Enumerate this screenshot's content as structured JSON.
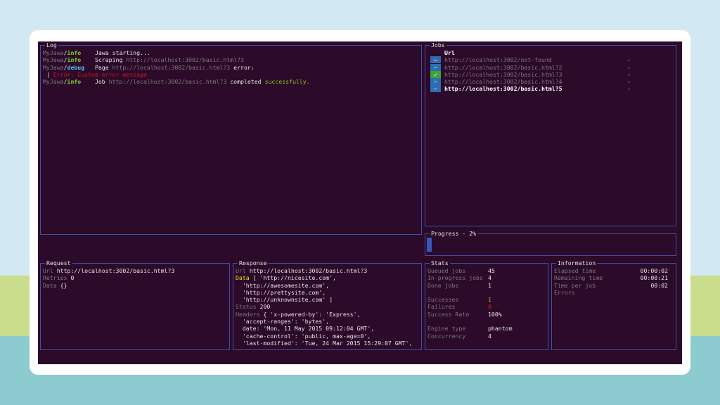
{
  "log": {
    "title": "Log",
    "lines": [
      {
        "source": "MyJawa",
        "level": "info",
        "message": "Jawa starting..."
      },
      {
        "source": "MyJawa",
        "level": "info",
        "message": "Scraping ",
        "url": "http://localhost:3002/basic.html?3"
      },
      {
        "source": "MyJawa",
        "level": "debug",
        "message": "Page ",
        "url": "http://localhost:3002/basic.html?3",
        "message2": " error:"
      },
      {
        "error": "Error: Custom error message"
      },
      {
        "source": "MyJawa",
        "level": "info",
        "message": "Job ",
        "url": "http://localhost:3002/basic.html?3",
        "message2": " completed ",
        "success": "successfully."
      }
    ]
  },
  "jobs": {
    "title": "Jobs",
    "header": "Url",
    "items": [
      {
        "icon": "minus",
        "status": "pending",
        "url": "http://localhost:3002/not-found",
        "value": "-",
        "active": false
      },
      {
        "icon": "minus",
        "status": "pending",
        "url": "http://localhost:3002/basic.html?2",
        "value": "-",
        "active": false
      },
      {
        "icon": "check",
        "status": "done",
        "url": "http://localhost:3002/basic.html?3",
        "value": "-",
        "active": false
      },
      {
        "icon": "minus",
        "status": "pending",
        "url": "http://localhost:3002/basic.html?4",
        "value": "-",
        "active": false
      },
      {
        "icon": "minus",
        "status": "pending",
        "url": "http://localhost:3002/basic.html?5",
        "value": "-",
        "active": true
      }
    ],
    "icons": {
      "minus": "−",
      "check": "✓"
    }
  },
  "progress": {
    "title": "Progress - 2%",
    "percent": 2
  },
  "request": {
    "title": "Request",
    "url_label": "Url",
    "url": "http://localhost:3002/basic.html?3",
    "retries_label": "Retries",
    "retries": "0",
    "data_label": "Data",
    "data": "{}"
  },
  "response": {
    "title": "Response",
    "url_label": "Url",
    "url": "http://localhost:3002/basic.html?3",
    "data_label": "Data",
    "data_lines": [
      "[ 'http://nicesite.com',",
      "  'http://awesomesite.com',",
      "  'http://prettysite.com',",
      "  'http://unknownsite.com' ]"
    ],
    "status_label": "Status",
    "status": "200",
    "headers_label": "Headers",
    "header_lines": [
      "{ 'x-powered-by': 'Express',",
      "  'accept-ranges': 'bytes',",
      "  date: 'Mon, 11 May 2015 09:12:04 GMT',",
      "  'cache-control': 'public, max-age=0',",
      "  'last-modified': 'Tue, 24 Mar 2015 15:29:07 GMT',"
    ]
  },
  "stats": {
    "title": "Stats",
    "rows": [
      {
        "label": "Queued jobs",
        "value": "45"
      },
      {
        "label": "In-progress jobs",
        "value": "4"
      },
      {
        "label": "Done jobs",
        "value": "1"
      },
      {
        "label": "",
        "value": ""
      },
      {
        "label": "Successes",
        "value": "1",
        "color": "green"
      },
      {
        "label": "Failures",
        "value": "0",
        "color": "red"
      },
      {
        "label": "Success Rate",
        "value": "100%"
      },
      {
        "label": "",
        "value": ""
      },
      {
        "label": "Engine type",
        "value": "phantom"
      },
      {
        "label": "Concurrency",
        "value": "4"
      }
    ]
  },
  "information": {
    "title": "Information",
    "rows": [
      {
        "label": "Elapsed time",
        "value": "00:00:02"
      },
      {
        "label": "Remaining time",
        "value": "00:00:21"
      },
      {
        "label": "Time per job",
        "value": "00:02"
      },
      {
        "label": "Errors",
        "value": ""
      }
    ]
  },
  "colors": {
    "terminal_bg": "#2c0a29",
    "border": "#3f51a6",
    "info": "#7fd02e",
    "debug": "#51c6ea",
    "error": "#d11a1a",
    "success": "#8ac926"
  }
}
